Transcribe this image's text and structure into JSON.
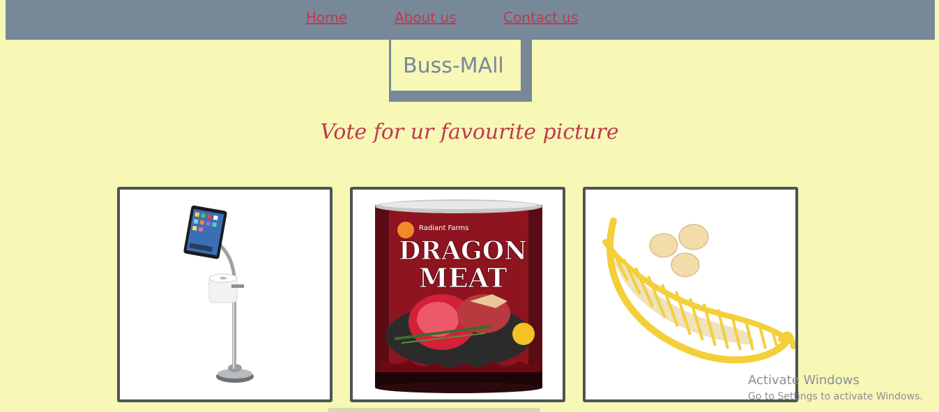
{
  "nav": {
    "home": "Home",
    "about": "About us",
    "contact": "Contact us"
  },
  "logo": "Buss-MAll",
  "headline": "Vote for ur favourite picture",
  "products": [
    {
      "name": "toilet-paper-ipad-stand",
      "image_icon": "bathroom-stand-image"
    },
    {
      "name": "dragon-meat-can",
      "image_icon": "dragon-meat-image",
      "brand": "Radiant Farms",
      "line1": "DRAGON",
      "line2": "MEAT"
    },
    {
      "name": "banana-slicer",
      "image_icon": "banana-slicer-image"
    }
  ],
  "watermark": {
    "title": "Activate Windows",
    "subtitle": "Go to Settings to activate Windows."
  },
  "colors": {
    "page_bg": "#f7f7b6",
    "nav_bg": "#778899",
    "accent": "#c0394f",
    "card_border": "#4d5452"
  }
}
